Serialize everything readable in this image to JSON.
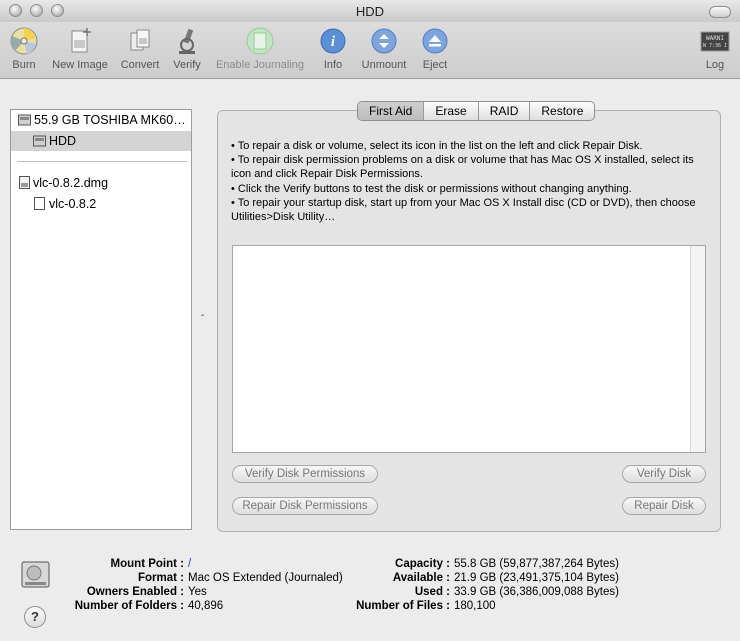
{
  "window": {
    "title": "HDD"
  },
  "toolbar": {
    "items": [
      {
        "label": "Burn",
        "icon": "burn-icon"
      },
      {
        "label": "New Image",
        "icon": "new-image-icon"
      },
      {
        "label": "Convert",
        "icon": "convert-icon"
      },
      {
        "label": "Verify",
        "icon": "verify-icon"
      },
      {
        "label": "Enable Journaling",
        "icon": "enable-journaling-icon"
      },
      {
        "label": "Info",
        "icon": "info-icon"
      },
      {
        "label": "Unmount",
        "icon": "unmount-icon"
      },
      {
        "label": "Eject",
        "icon": "eject-icon"
      },
      {
        "label": "Log",
        "icon": "log-icon"
      }
    ],
    "log_icon_text": [
      "WARNI",
      "N 7:36 I"
    ]
  },
  "sidebar": {
    "items": [
      {
        "label": "55.9 GB TOSHIBA MK60…",
        "icon": "hard-disk-icon"
      },
      {
        "label": "HDD",
        "icon": "volume-icon",
        "selected": true
      },
      {
        "label": "vlc-0.8.2.dmg",
        "icon": "disk-image-icon"
      },
      {
        "label": "vlc-0.8.2",
        "icon": "volume-icon"
      }
    ]
  },
  "tabs": [
    "First Aid",
    "Erase",
    "RAID",
    "Restore"
  ],
  "active_tab": "First Aid",
  "first_aid": {
    "instructions": [
      "• To repair a disk or volume, select its icon in the list on the left and click Repair Disk.",
      "• To repair disk permission problems on a disk or volume that has Mac OS X installed, select its icon and click Repair Disk Permissions.",
      "• Click the Verify buttons to test the disk or permissions without changing anything.",
      "• To repair your startup disk, start up from your Mac OS X Install disc (CD or DVD), then choose Utilities>Disk Utility…"
    ],
    "buttons": {
      "verify_permissions": "Verify Disk Permissions",
      "verify_disk": "Verify Disk",
      "repair_permissions": "Repair Disk Permissions",
      "repair_disk": "Repair Disk"
    }
  },
  "info": {
    "left": [
      {
        "key": "Mount Point :",
        "value": "/"
      },
      {
        "key": "Format :",
        "value": "Mac OS Extended (Journaled)"
      },
      {
        "key": "Owners Enabled :",
        "value": "Yes"
      },
      {
        "key": "Number of Folders :",
        "value": "40,896"
      }
    ],
    "right": [
      {
        "key": "Capacity :",
        "value": "55.8 GB (59,877,387,264 Bytes)"
      },
      {
        "key": "Available :",
        "value": "21.9 GB (23,491,375,104 Bytes)"
      },
      {
        "key": "Used :",
        "value": "33.9 GB (36,386,009,088 Bytes)"
      },
      {
        "key": "Number of Files :",
        "value": "180,100"
      }
    ],
    "help_label": "?"
  },
  "colors": {
    "mount_point_link": "#2a35c8",
    "toolbar_icon_blue": "#5b8fd6"
  }
}
